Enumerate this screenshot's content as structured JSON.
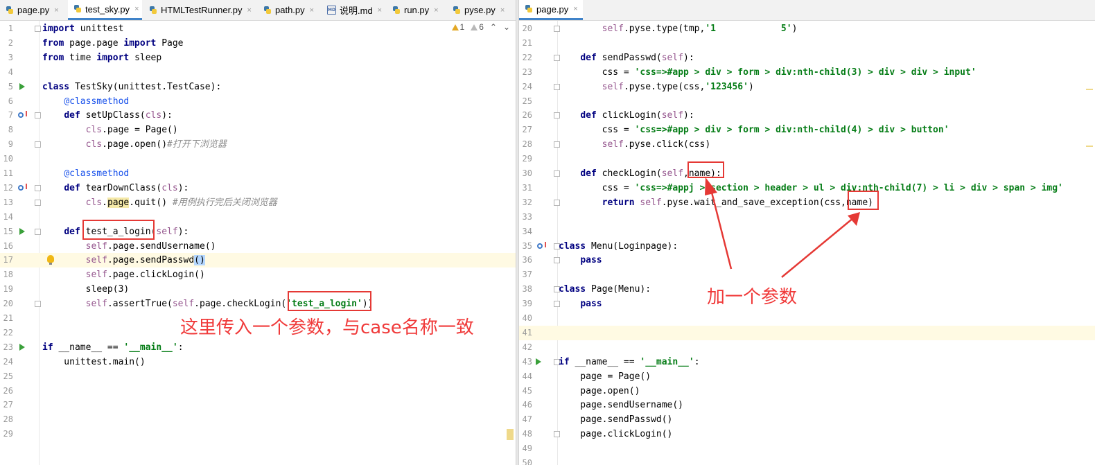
{
  "tabs_left": [
    {
      "label": "page.py",
      "icon": "python-file-icon",
      "active": false
    },
    {
      "label": "test_sky.py",
      "icon": "python-file-icon",
      "active": true
    },
    {
      "label": "HTMLTestRunner.py",
      "icon": "python-file-icon",
      "active": false
    },
    {
      "label": "path.py",
      "icon": "python-file-icon",
      "active": false
    },
    {
      "label": "说明.md",
      "icon": "markdown-file-icon",
      "active": false
    },
    {
      "label": "run.py",
      "icon": "python-file-icon",
      "active": false
    },
    {
      "label": "pyse.py",
      "icon": "python-file-icon",
      "active": false
    }
  ],
  "tabs_right": [
    {
      "label": "page.py",
      "icon": "python-file-icon",
      "active": true
    }
  ],
  "close_glyph": "×",
  "inspection": {
    "warnings": "1",
    "weak_warnings": "6",
    "up": "⌃",
    "down": "⌄"
  },
  "left_editor": {
    "lines": [
      {
        "n": "1",
        "t": [
          {
            "c": "kw",
            "s": "import"
          },
          {
            "s": " unittest"
          }
        ],
        "fold": true
      },
      {
        "n": "2",
        "t": [
          {
            "c": "kw",
            "s": "from"
          },
          {
            "s": " page.page "
          },
          {
            "c": "kw",
            "s": "import"
          },
          {
            "s": " Page"
          }
        ]
      },
      {
        "n": "3",
        "t": [
          {
            "c": "kw",
            "s": "from"
          },
          {
            "s": " time "
          },
          {
            "c": "kw",
            "s": "import"
          },
          {
            "s": " sleep"
          }
        ]
      },
      {
        "n": "4",
        "t": []
      },
      {
        "n": "5",
        "t": [
          {
            "c": "kw",
            "s": "class"
          },
          {
            "s": " TestSky(unittest.TestCase):"
          }
        ],
        "run": true
      },
      {
        "n": "6",
        "t": [
          {
            "s": "    "
          },
          {
            "c": "deco",
            "s": "@classmethod"
          }
        ]
      },
      {
        "n": "7",
        "t": [
          {
            "s": "    "
          },
          {
            "c": "kw",
            "s": "def"
          },
          {
            "s": " setUpClass("
          },
          {
            "c": "self",
            "s": "cls"
          },
          {
            "s": "):"
          }
        ],
        "ov": true,
        "fold": true
      },
      {
        "n": "8",
        "t": [
          {
            "s": "        "
          },
          {
            "c": "self",
            "s": "cls"
          },
          {
            "s": ".page = Page()"
          }
        ]
      },
      {
        "n": "9",
        "t": [
          {
            "s": "        "
          },
          {
            "c": "self",
            "s": "cls"
          },
          {
            "s": ".page.open()"
          },
          {
            "c": "cmt",
            "s": "#打开下浏览器"
          }
        ],
        "fold": true
      },
      {
        "n": "10",
        "t": []
      },
      {
        "n": "11",
        "t": [
          {
            "s": "    "
          },
          {
            "c": "deco",
            "s": "@classmethod"
          }
        ]
      },
      {
        "n": "12",
        "t": [
          {
            "s": "    "
          },
          {
            "c": "kw",
            "s": "def"
          },
          {
            "s": " tearDownClass("
          },
          {
            "c": "self",
            "s": "cls"
          },
          {
            "s": "):"
          }
        ],
        "ov": true,
        "fold": true
      },
      {
        "n": "13",
        "t": [
          {
            "s": "        "
          },
          {
            "c": "self",
            "s": "cls"
          },
          {
            "s": "."
          },
          {
            "c": "warnhl",
            "s": "page"
          },
          {
            "s": ".quit() "
          },
          {
            "c": "cmt",
            "s": "#用例执行完后关闭浏览器"
          }
        ],
        "fold": true
      },
      {
        "n": "14",
        "t": []
      },
      {
        "n": "15",
        "t": [
          {
            "s": "    "
          },
          {
            "c": "kw",
            "s": "def"
          },
          {
            "s": " test_a_login("
          },
          {
            "c": "self",
            "s": "self"
          },
          {
            "s": "):"
          }
        ],
        "run": true,
        "fold": true
      },
      {
        "n": "16",
        "t": [
          {
            "s": "        "
          },
          {
            "c": "self",
            "s": "self"
          },
          {
            "s": ".page.sendUsername()"
          }
        ]
      },
      {
        "n": "17",
        "t": [
          {
            "s": "        "
          },
          {
            "c": "self",
            "s": "self"
          },
          {
            "s": ".page.sendPasswd"
          },
          {
            "c": "bracehl",
            "s": "()"
          }
        ],
        "hl": true,
        "bulb": true
      },
      {
        "n": "18",
        "t": [
          {
            "s": "        "
          },
          {
            "c": "self",
            "s": "self"
          },
          {
            "s": ".page.clickLogin()"
          }
        ]
      },
      {
        "n": "19",
        "t": [
          {
            "s": "        sleep(3)"
          }
        ]
      },
      {
        "n": "20",
        "t": [
          {
            "s": "        "
          },
          {
            "c": "self",
            "s": "self"
          },
          {
            "s": ".assertTrue("
          },
          {
            "c": "self",
            "s": "self"
          },
          {
            "s": ".page.checkLogin("
          },
          {
            "c": "str",
            "s": "'test_a_login'"
          },
          {
            "s": "))"
          }
        ],
        "fold": true
      },
      {
        "n": "21",
        "t": []
      },
      {
        "n": "22",
        "t": []
      },
      {
        "n": "23",
        "t": [
          {
            "c": "kw",
            "s": "if"
          },
          {
            "s": " __name__ == "
          },
          {
            "c": "str",
            "s": "'__main__'"
          },
          {
            "s": ":"
          }
        ],
        "run": true
      },
      {
        "n": "24",
        "t": [
          {
            "s": "    unittest.main()"
          }
        ]
      },
      {
        "n": "25",
        "t": []
      },
      {
        "n": "26",
        "t": []
      },
      {
        "n": "27",
        "t": []
      },
      {
        "n": "28",
        "t": []
      },
      {
        "n": "29",
        "t": []
      }
    ]
  },
  "right_editor": {
    "lines": [
      {
        "n": "20",
        "t": [
          {
            "s": "        "
          },
          {
            "c": "self",
            "s": "self"
          },
          {
            "s": ".pyse.type(tmp,"
          },
          {
            "c": "str",
            "s": "'1            5'"
          },
          {
            "s": ")"
          }
        ],
        "fold": true
      },
      {
        "n": "21",
        "t": []
      },
      {
        "n": "22",
        "t": [
          {
            "s": "    "
          },
          {
            "c": "kw",
            "s": "def"
          },
          {
            "s": " sendPasswd("
          },
          {
            "c": "self",
            "s": "self"
          },
          {
            "s": "):"
          }
        ],
        "fold": true
      },
      {
        "n": "23",
        "t": [
          {
            "s": "        css = "
          },
          {
            "c": "str",
            "s": "'css=>#app > div > form > div:nth-child(3) > div > div > input'"
          }
        ]
      },
      {
        "n": "24",
        "t": [
          {
            "s": "        "
          },
          {
            "c": "self",
            "s": "self"
          },
          {
            "s": ".pyse.type(css,"
          },
          {
            "c": "str",
            "s": "'123456'"
          },
          {
            "s": ")"
          }
        ],
        "fold": true
      },
      {
        "n": "25",
        "t": []
      },
      {
        "n": "26",
        "t": [
          {
            "s": "    "
          },
          {
            "c": "kw",
            "s": "def"
          },
          {
            "s": " clickLogin("
          },
          {
            "c": "self",
            "s": "self"
          },
          {
            "s": "):"
          }
        ],
        "fold": true
      },
      {
        "n": "27",
        "t": [
          {
            "s": "        css = "
          },
          {
            "c": "str",
            "s": "'css=>#app > div > form > div:nth-child(4) > div > button'"
          }
        ]
      },
      {
        "n": "28",
        "t": [
          {
            "s": "        "
          },
          {
            "c": "self",
            "s": "self"
          },
          {
            "s": ".pyse.click(css)"
          }
        ],
        "fold": true
      },
      {
        "n": "29",
        "t": []
      },
      {
        "n": "30",
        "t": [
          {
            "s": "    "
          },
          {
            "c": "kw",
            "s": "def"
          },
          {
            "s": " checkLogin("
          },
          {
            "c": "self",
            "s": "self"
          },
          {
            "s": ",name):"
          }
        ],
        "fold": true
      },
      {
        "n": "31",
        "t": [
          {
            "s": "        css = "
          },
          {
            "c": "str",
            "s": "'css=>#appj > section > header > ul > div:nth-child(7) > li > div > span > img'"
          }
        ]
      },
      {
        "n": "32",
        "t": [
          {
            "s": "        "
          },
          {
            "c": "kw",
            "s": "return"
          },
          {
            "s": " "
          },
          {
            "c": "self",
            "s": "self"
          },
          {
            "s": ".pyse.wait_and_save_exception(css,name)"
          }
        ],
        "fold": true
      },
      {
        "n": "33",
        "t": []
      },
      {
        "n": "34",
        "t": []
      },
      {
        "n": "35",
        "t": [
          {
            "c": "kw",
            "s": "class"
          },
          {
            "s": " Menu(Loginpage):"
          }
        ],
        "ov": true,
        "fold": true
      },
      {
        "n": "36",
        "t": [
          {
            "s": "    "
          },
          {
            "c": "kw",
            "s": "pass"
          }
        ],
        "fold": true
      },
      {
        "n": "37",
        "t": []
      },
      {
        "n": "38",
        "t": [
          {
            "c": "kw",
            "s": "class"
          },
          {
            "s": " Page(Menu):"
          }
        ],
        "fold": true
      },
      {
        "n": "39",
        "t": [
          {
            "s": "    "
          },
          {
            "c": "kw",
            "s": "pass"
          }
        ],
        "fold": true
      },
      {
        "n": "40",
        "t": []
      },
      {
        "n": "41",
        "t": [],
        "hl": true
      },
      {
        "n": "42",
        "t": []
      },
      {
        "n": "43",
        "t": [
          {
            "c": "kw",
            "s": "if"
          },
          {
            "s": " __name__ == "
          },
          {
            "c": "str",
            "s": "'__main__'"
          },
          {
            "s": ":"
          }
        ],
        "run": true,
        "fold": true
      },
      {
        "n": "44",
        "t": [
          {
            "s": "    page = Page()"
          }
        ]
      },
      {
        "n": "45",
        "t": [
          {
            "s": "    page.open()"
          }
        ]
      },
      {
        "n": "46",
        "t": [
          {
            "s": "    page.sendUsername()"
          }
        ]
      },
      {
        "n": "47",
        "t": [
          {
            "s": "    page.sendPasswd()"
          }
        ]
      },
      {
        "n": "48",
        "t": [
          {
            "s": "    page.clickLogin()"
          }
        ],
        "fold": true
      },
      {
        "n": "49",
        "t": []
      },
      {
        "n": "50",
        "t": []
      }
    ]
  },
  "annotations": {
    "left_note": "这里传入一个参数，与case名称一致",
    "right_note": "加一个参数"
  },
  "colors": {
    "annotation_red": "#e53935",
    "active_tab_underline": "#4083c9"
  }
}
